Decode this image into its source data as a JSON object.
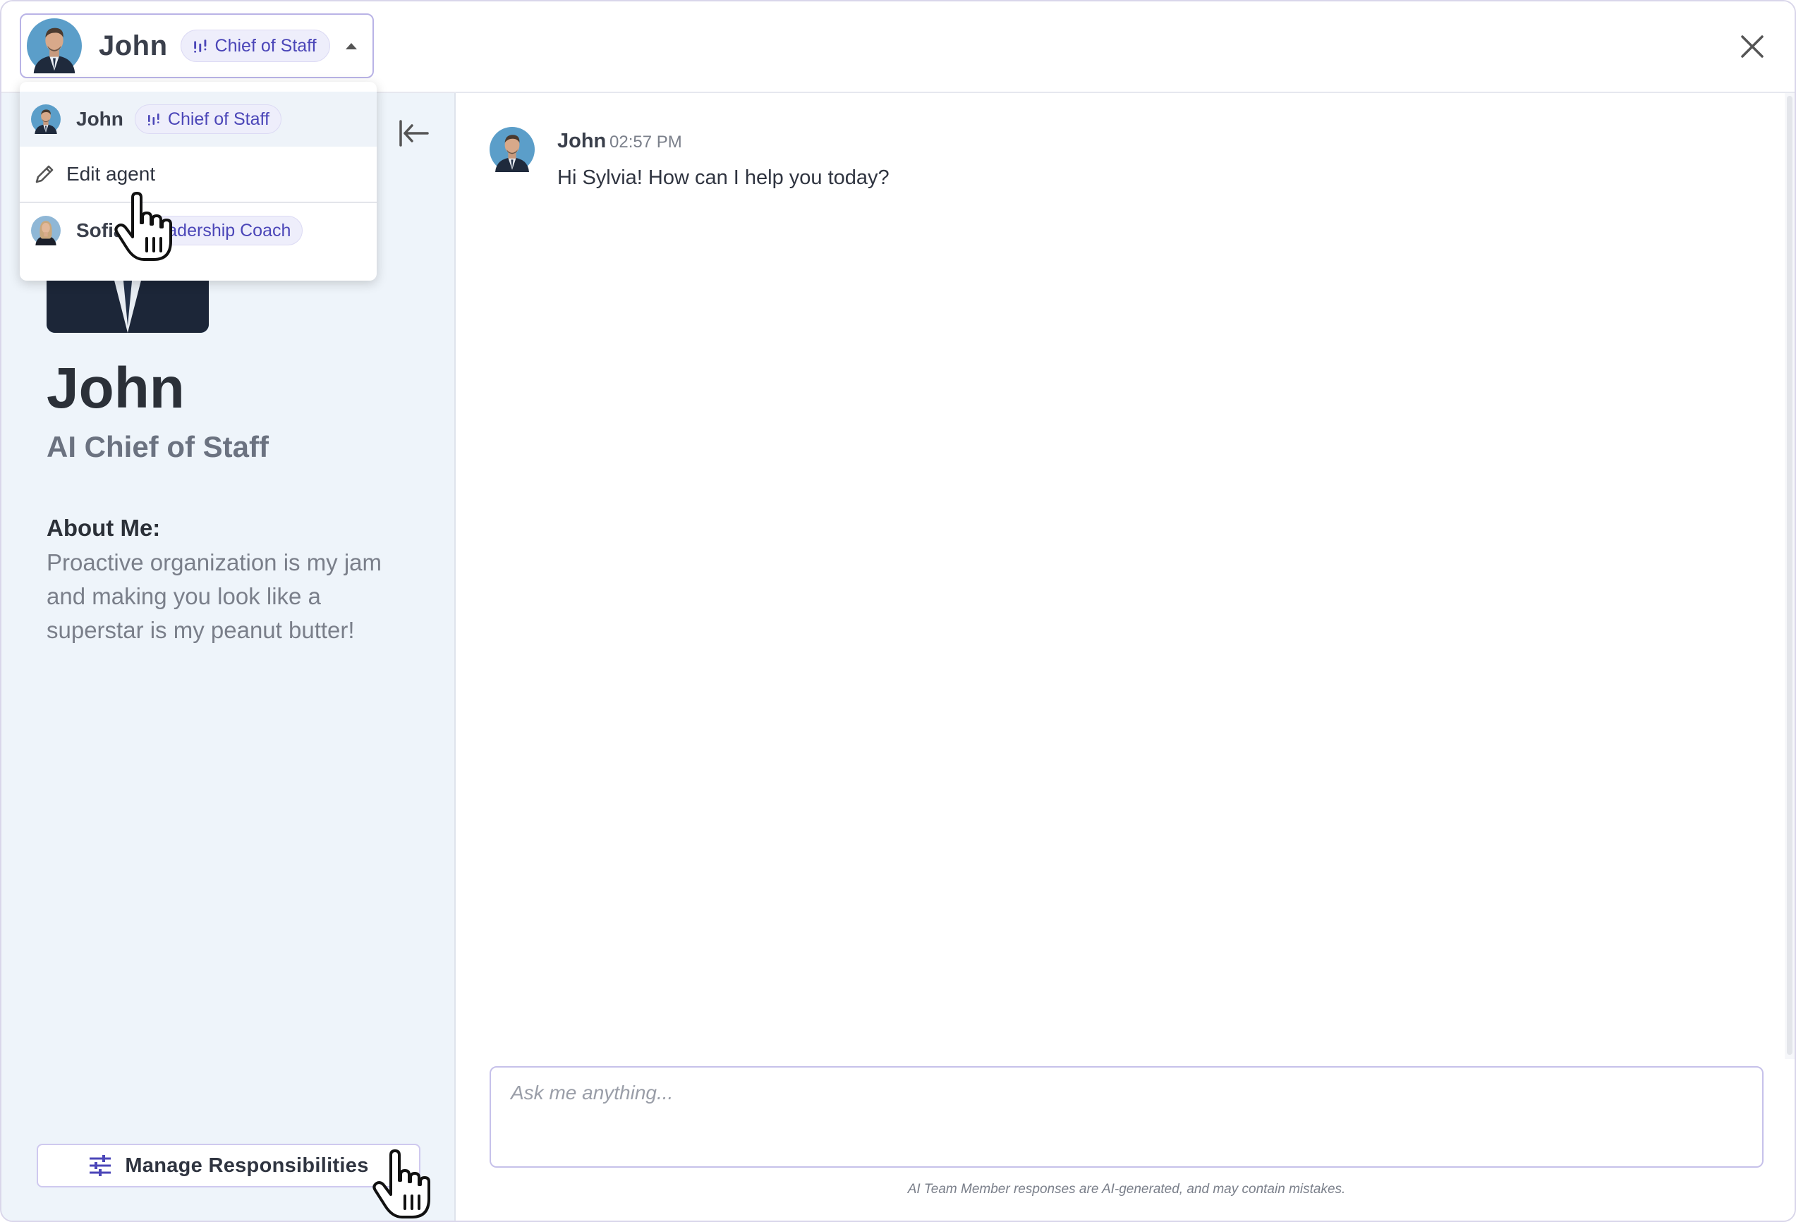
{
  "header": {
    "agent_name": "John",
    "agent_role": "Chief of Staff"
  },
  "dropdown": {
    "items": [
      {
        "name": "John",
        "role": "Chief of Staff",
        "selected": true
      },
      {
        "action_label": "Edit agent"
      },
      {
        "name": "Sofia",
        "role": "Leadership Coach",
        "selected": false
      }
    ]
  },
  "profile": {
    "name": "John",
    "title": "AI Chief of Staff",
    "about_label": "About Me:",
    "about_text": "Proactive organization is my jam and making you look like a superstar is my peanut butter!",
    "manage_button": "Manage Responsibilities"
  },
  "chat": {
    "messages": [
      {
        "sender": "John",
        "time": "02:57 PM",
        "text": "Hi Sylvia! How can I help you today?"
      }
    ],
    "input_placeholder": "Ask me anything...",
    "disclaimer": "AI Team Member responses are AI-generated, and may contain mistakes."
  },
  "colors": {
    "accent": "#4b46b8",
    "panel_bg": "#eef4fa",
    "border": "#c6c1ea"
  },
  "icons": [
    "agent-avatar",
    "bar-chart-icon",
    "caret-up-icon",
    "close-icon",
    "collapse-panel-icon",
    "pencil-icon",
    "sliders-icon",
    "hand-cursor-icon"
  ]
}
